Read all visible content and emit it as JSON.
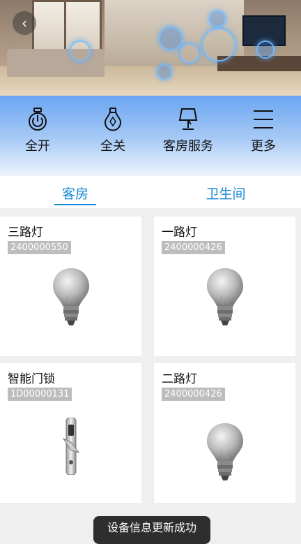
{
  "header": {
    "back_icon": "chevron-left-icon"
  },
  "actions": [
    {
      "label": "全开",
      "icon": "bulb-power-icon"
    },
    {
      "label": "全关",
      "icon": "bulb-off-icon"
    },
    {
      "label": "客房服务",
      "icon": "lamp-icon"
    },
    {
      "label": "更多",
      "icon": "menu-icon"
    }
  ],
  "tabs": [
    {
      "label": "客房",
      "active": true
    },
    {
      "label": "卫生间",
      "active": false
    }
  ],
  "devices": [
    {
      "name": "三路灯",
      "code": "2400000550",
      "icon": "light-bulb-icon"
    },
    {
      "name": "一路灯",
      "code": "2400000426",
      "icon": "light-bulb-icon"
    },
    {
      "name": "智能门锁",
      "code": "1D00000131",
      "icon": "door-lock-icon"
    },
    {
      "name": "二路灯",
      "code": "2400000426",
      "icon": "light-bulb-icon"
    }
  ],
  "toast": {
    "message": "设备信息更新成功"
  },
  "colors": {
    "accent": "#1a8ad6",
    "action_bar_top": "#6aa5f2",
    "code_badge": "#bdbdbd"
  }
}
